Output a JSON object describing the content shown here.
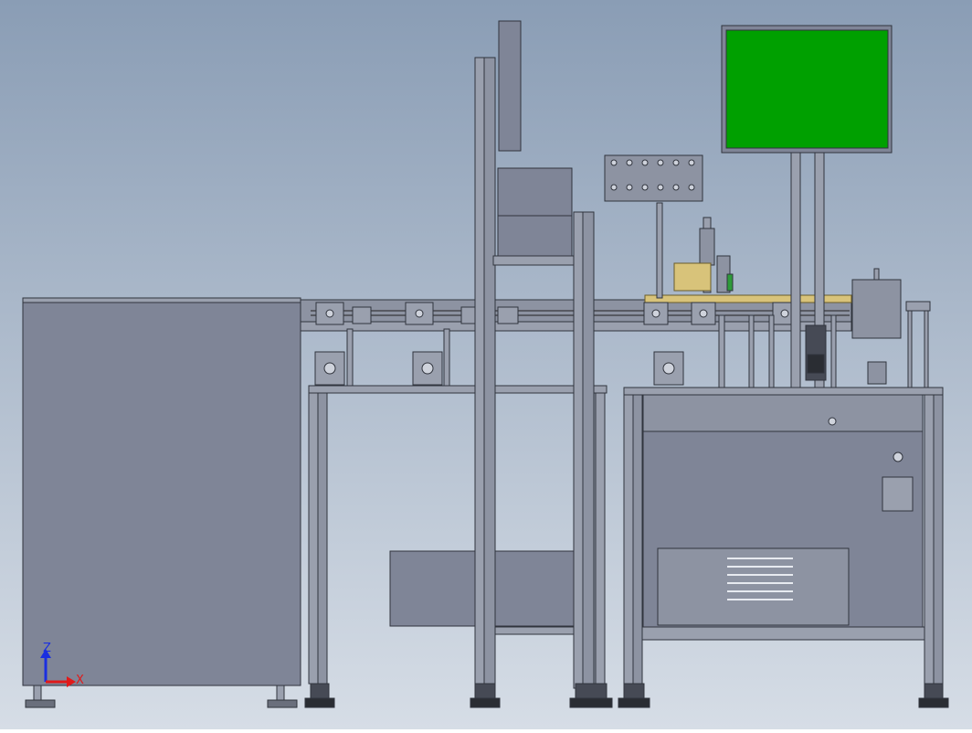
{
  "viewport": {
    "background_top": "#8a9db5",
    "background_bottom": "#d6dde6",
    "part_fill": "#7f8597",
    "part_stroke": "#30343d",
    "frame_fill": "#9aa0ae",
    "screen_fill": "#00a000",
    "accent_yellow": "#d8c37a"
  },
  "triad": {
    "z_label": "Z",
    "x_label": "X",
    "z_color": "#1a2fe0",
    "x_color": "#e01a1a"
  }
}
